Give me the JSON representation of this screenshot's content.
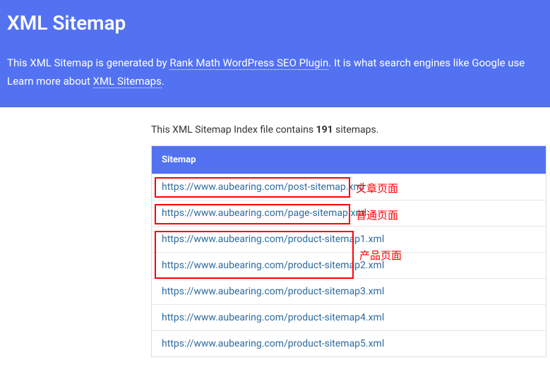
{
  "header": {
    "title": "XML Sitemap",
    "desc_prefix": "This XML Sitemap is generated by ",
    "desc_link1": "Rank Math WordPress SEO Plugin",
    "desc_mid": ". It is what search engines like Google use",
    "desc_line2_prefix": "Learn more about ",
    "desc_link2": "XML Sitemaps",
    "desc_line2_suffix": "."
  },
  "intro": {
    "prefix": "This XML Sitemap Index file contains ",
    "count": "191",
    "suffix": " sitemaps."
  },
  "table": {
    "col_header": "Sitemap",
    "rows": [
      "https://www.aubearing.com/post-sitemap.xml",
      "https://www.aubearing.com/page-sitemap.xml",
      "https://www.aubearing.com/product-sitemap1.xml",
      "https://www.aubearing.com/product-sitemap2.xml",
      "https://www.aubearing.com/product-sitemap3.xml",
      "https://www.aubearing.com/product-sitemap4.xml",
      "https://www.aubearing.com/product-sitemap5.xml"
    ]
  },
  "annotations": {
    "a1": "文章页面",
    "a2": "普通页面",
    "a3": "产品页面"
  }
}
